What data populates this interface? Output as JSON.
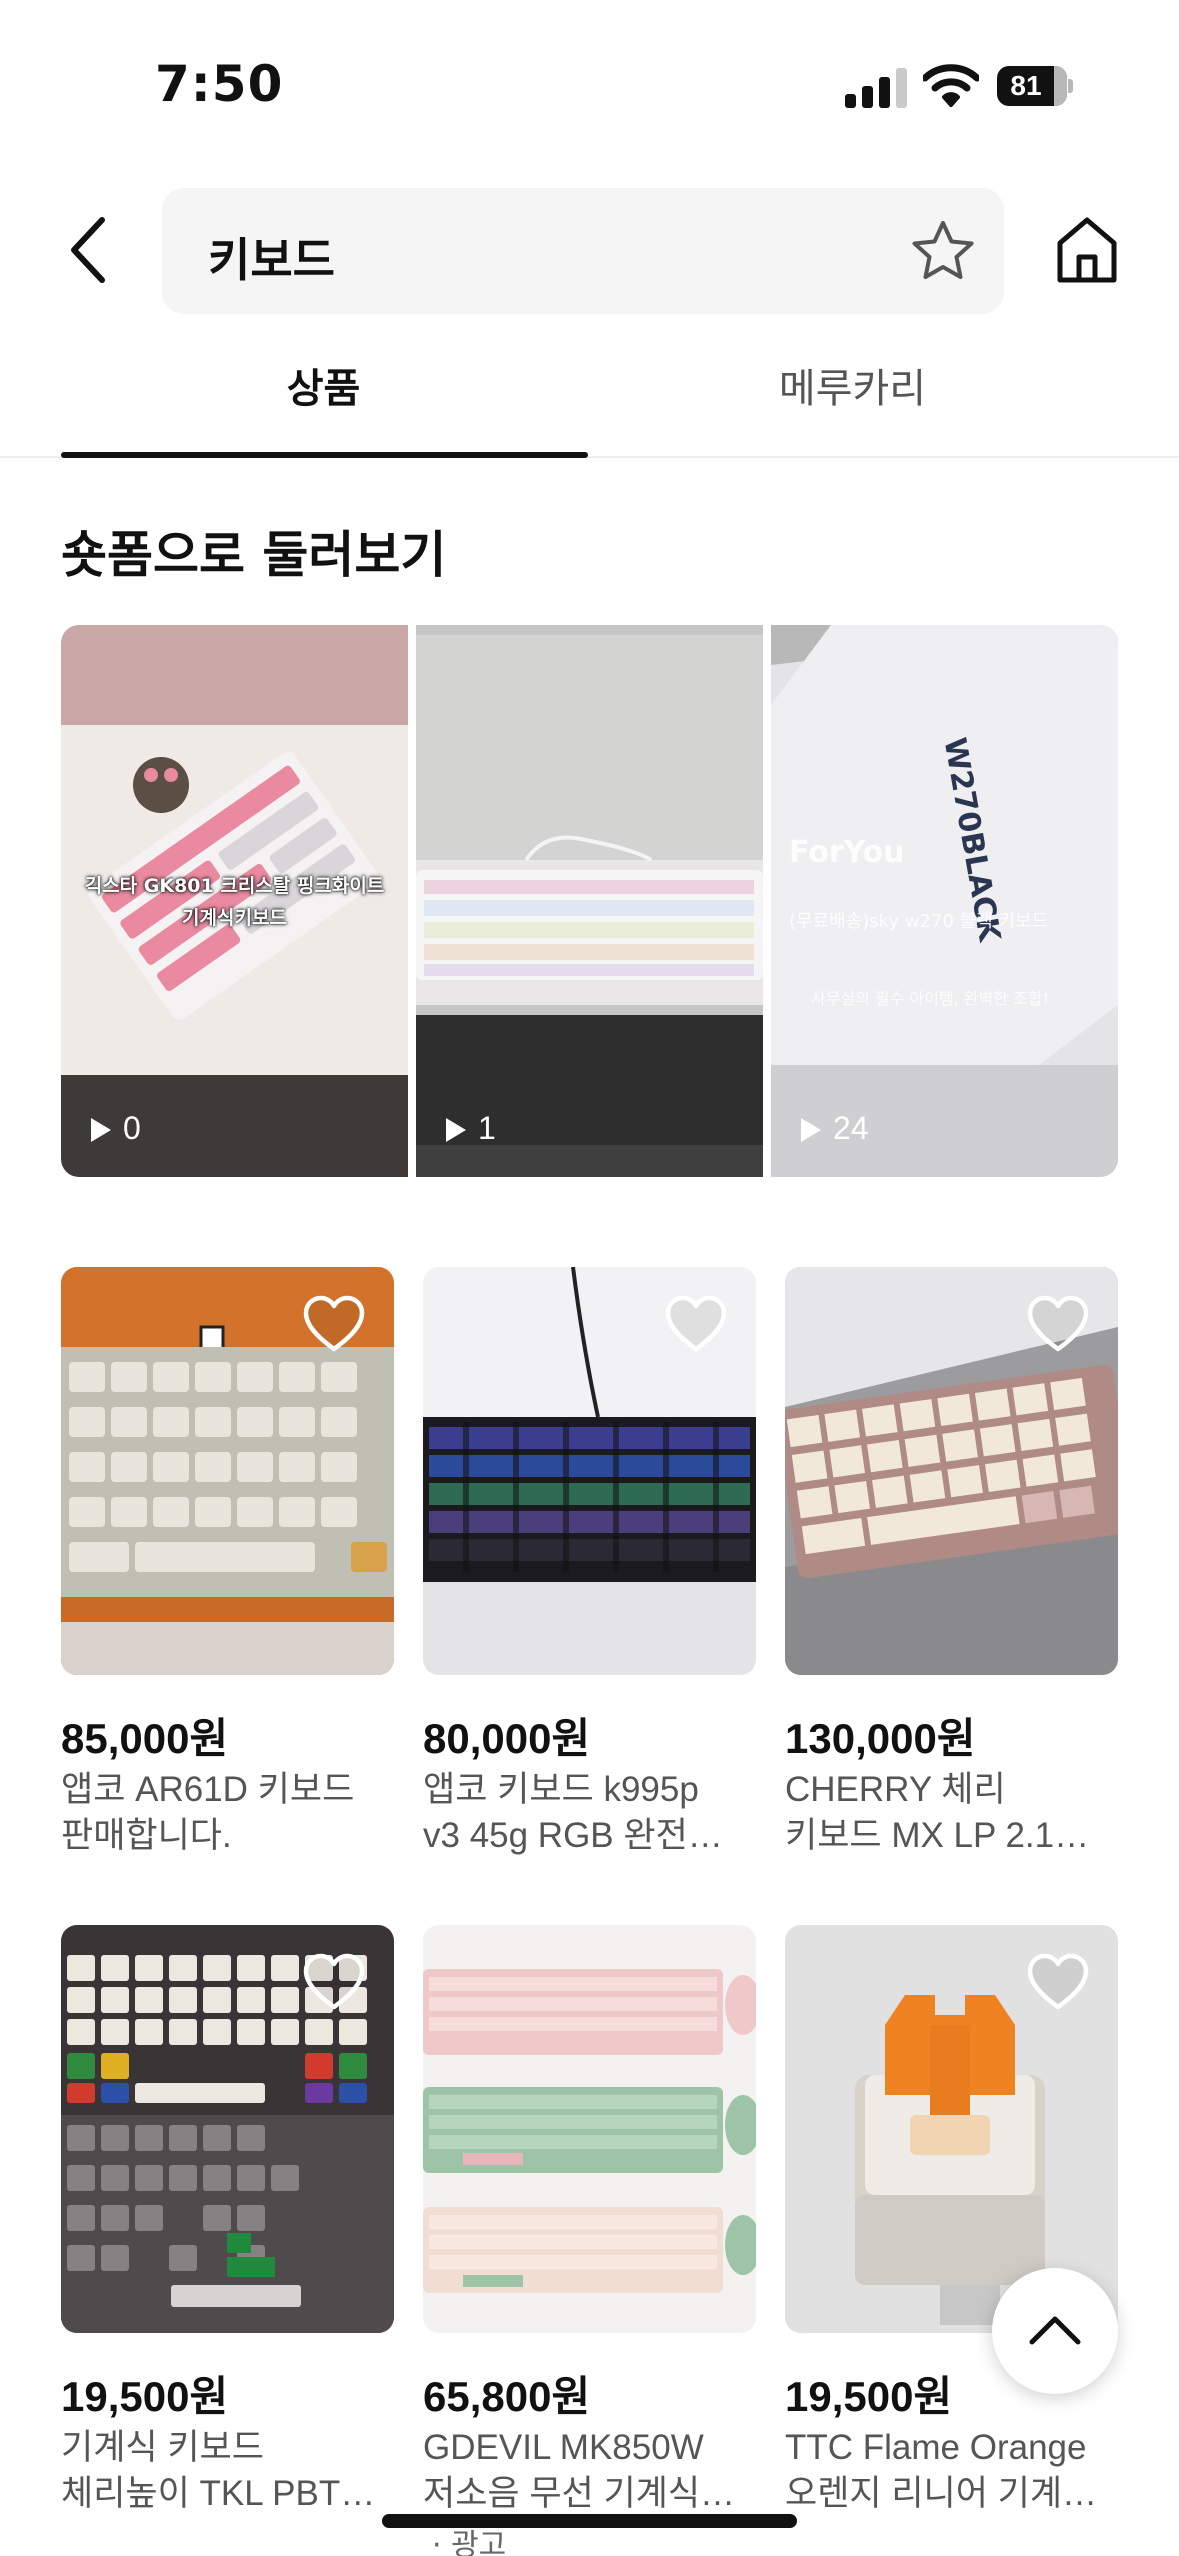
{
  "status": {
    "time": "7:50",
    "battery": "81",
    "battery_level": 0.81
  },
  "header": {
    "query": "키보드"
  },
  "tabs": [
    {
      "label": "상품",
      "active": true
    },
    {
      "label": "메루카리",
      "active": false
    }
  ],
  "shorts": {
    "title": "숏폼으로 둘러보기",
    "items": [
      {
        "views": "0",
        "caption": "긱스타 GK801 크리스탈 핑크화이트 기계식키보드"
      },
      {
        "views": "1",
        "caption": ""
      },
      {
        "views": "24",
        "caption": "(무료배송)sky w270 블랙 키보드",
        "tag": "ForYou",
        "sub": "사무실의 필수 아이템, 완벽한 조합!",
        "box_text": "W270BLACK"
      }
    ]
  },
  "products": [
    {
      "price": "85,000원",
      "title1": "앱코 AR61D 키보드",
      "title2": "판매합니다."
    },
    {
      "price": "80,000원",
      "title1": "앱코 키보드 k995p",
      "title2": "v3 45g RGB 완전…"
    },
    {
      "price": "130,000원",
      "title1": "CHERRY 체리",
      "title2": "키보드 MX LP 2.1…"
    },
    {
      "price": "19,500원",
      "title1": "기계식 키보드",
      "title2": "체리높이 TKL PBT…"
    },
    {
      "price": "65,800원",
      "title1": "GDEVIL MK850W",
      "title2": "저소음 무선 기계식…"
    },
    {
      "price": "19,500원",
      "title1": "TTC Flame Orange",
      "title2": "오렌지 리니어 기계…"
    }
  ],
  "ad_label": "· 광고",
  "colors": {
    "text": "#111111",
    "sub_text": "#555555",
    "search_bg": "#f5f5f5",
    "pink": "#e98aa0",
    "orange": "#e77d1f"
  },
  "icons": [
    "back-arrow-icon",
    "star-icon",
    "home-icon",
    "play-icon",
    "heart-icon",
    "chevron-up-icon",
    "signal-icon",
    "wifi-icon",
    "battery-icon"
  ]
}
